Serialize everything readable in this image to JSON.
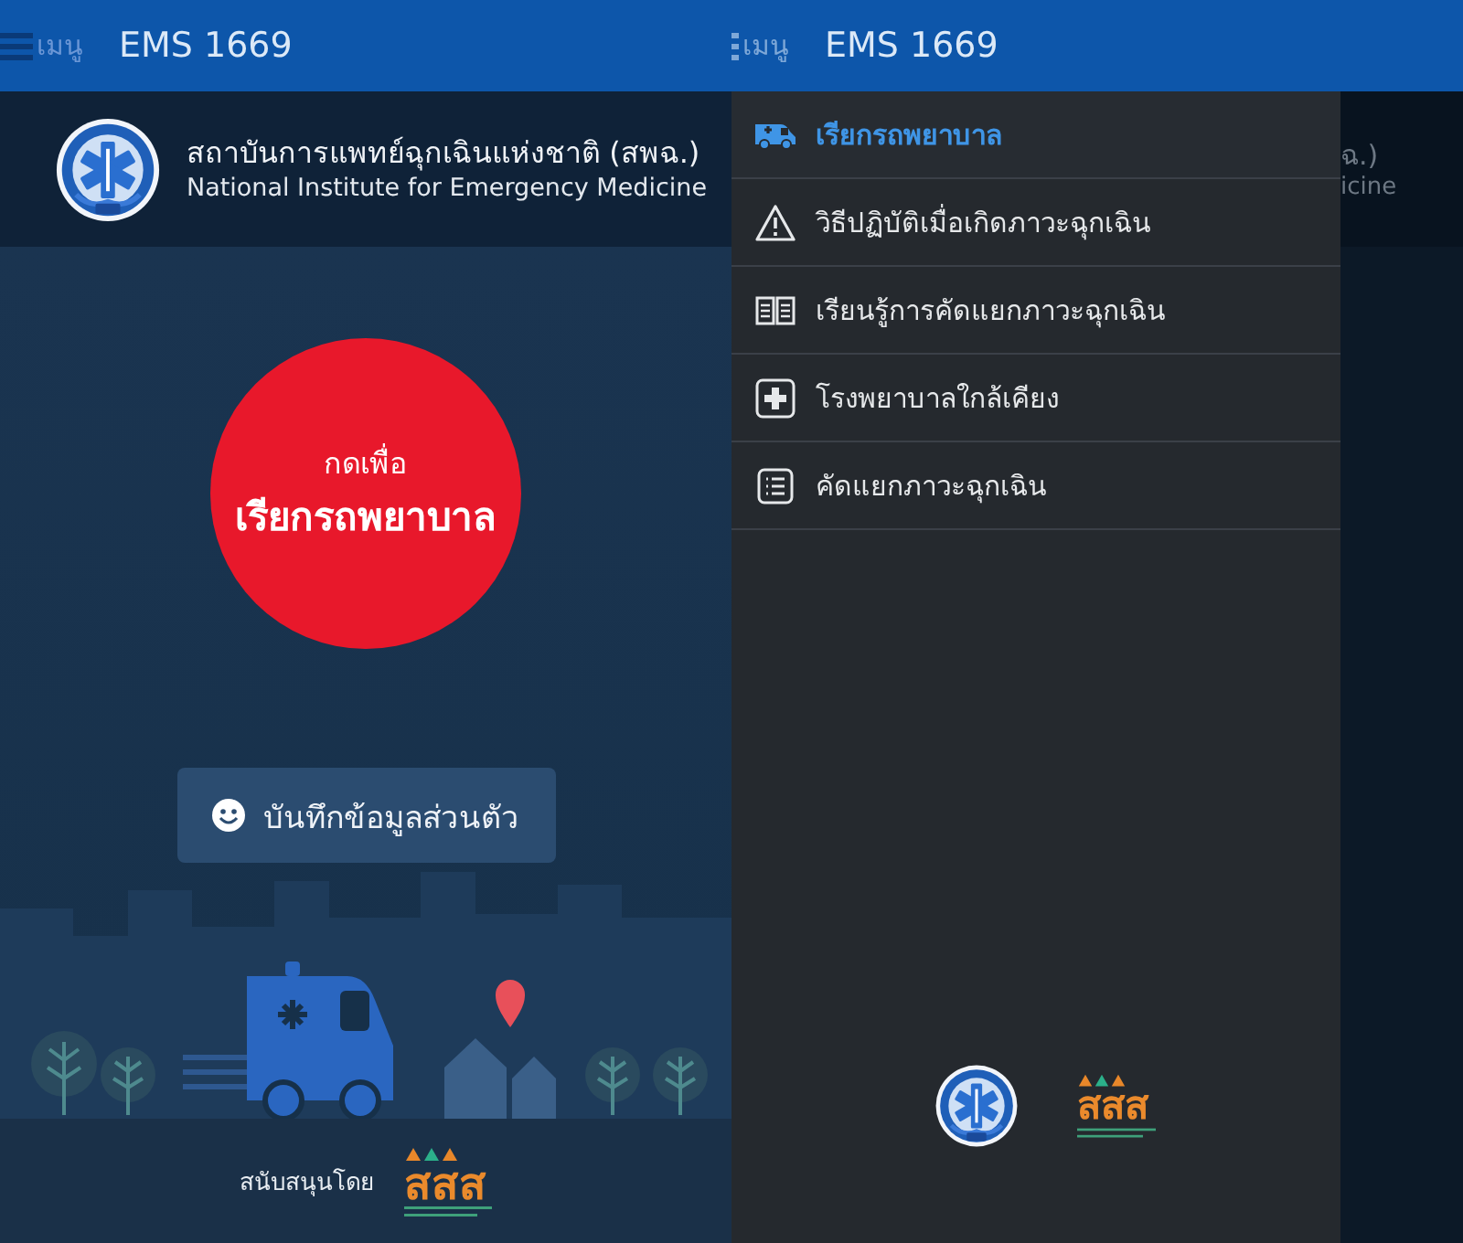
{
  "home_screen": {
    "app_bar": {
      "menu_label": "เมนู",
      "title": "EMS 1669"
    },
    "header": {
      "title": "สถาบันการแพทย์ฉุกเฉินแห่งชาติ (สพฉ.)",
      "subtitle": "National Institute for Emergency Medicine"
    },
    "call_button": {
      "prompt": "กดเพื่อ",
      "label": "เรียกรถพยาบาล"
    },
    "profile_button": {
      "label": "บันทึกข้อมูลส่วนตัว"
    },
    "footer": {
      "sponsor_label": "สนับสนุนโดย",
      "sponsor_logo": "สสส"
    }
  },
  "menu_screen": {
    "app_bar": {
      "menu_label": "เมนู",
      "title": "EMS 1669"
    },
    "drawer": {
      "items": [
        {
          "label": "เรียกรถพยาบาล",
          "selected": true
        },
        {
          "label": "วิธีปฏิบัติเมื่อเกิดภาวะฉุกเฉิน",
          "selected": false
        },
        {
          "label": "เรียนรู้การคัดแยกภาวะฉุกเฉิน",
          "selected": false
        },
        {
          "label": "โรงพยาบาลใกล้เคียง",
          "selected": false
        },
        {
          "label": "คัดแยกภาวะฉุกเฉิน",
          "selected": false
        }
      ],
      "sponsor_logo": "สสส"
    },
    "background_fragments": [
      "ฉ.)",
      "icine"
    ]
  }
}
